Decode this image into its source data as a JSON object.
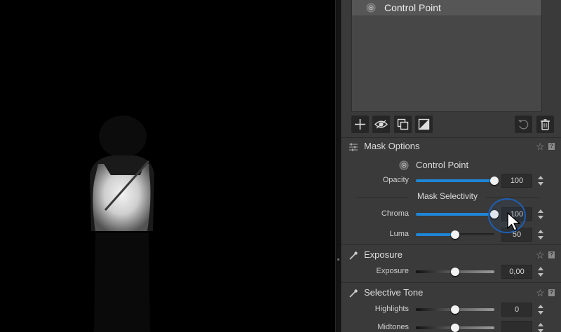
{
  "mask_list": {
    "selected_item": "Control Point"
  },
  "toolbar": {
    "add": "add-icon",
    "visibility": "eye-icon",
    "duplicate": "duplicate-icon",
    "invert": "invert-mask-icon",
    "reset": "reset-icon",
    "delete": "trash-icon"
  },
  "mask_options": {
    "title": "Mask Options",
    "control_point_label": "Control Point",
    "opacity": {
      "label": "Opacity",
      "value": "100",
      "level": 1.0
    },
    "selectivity_title": "Mask Selectivity",
    "chroma": {
      "label": "Chroma",
      "value": "100",
      "level": 1.0
    },
    "luma": {
      "label": "Luma",
      "value": "50",
      "level": 0.5
    }
  },
  "exposure": {
    "title": "Exposure",
    "exposure": {
      "label": "Exposure",
      "value": "0,00",
      "level": 0.5
    }
  },
  "selective_tone": {
    "title": "Selective Tone",
    "highlights": {
      "label": "Highlights",
      "value": "0",
      "level": 0.5
    },
    "midtones": {
      "label": "Midtones",
      "value": "",
      "level": 0.5
    }
  },
  "ui": {
    "star": "☆",
    "help": "?"
  },
  "colors": {
    "accent": "#1f86d6",
    "panel": "#3a3a3a",
    "cursor_ring": "#1e5fb4"
  }
}
